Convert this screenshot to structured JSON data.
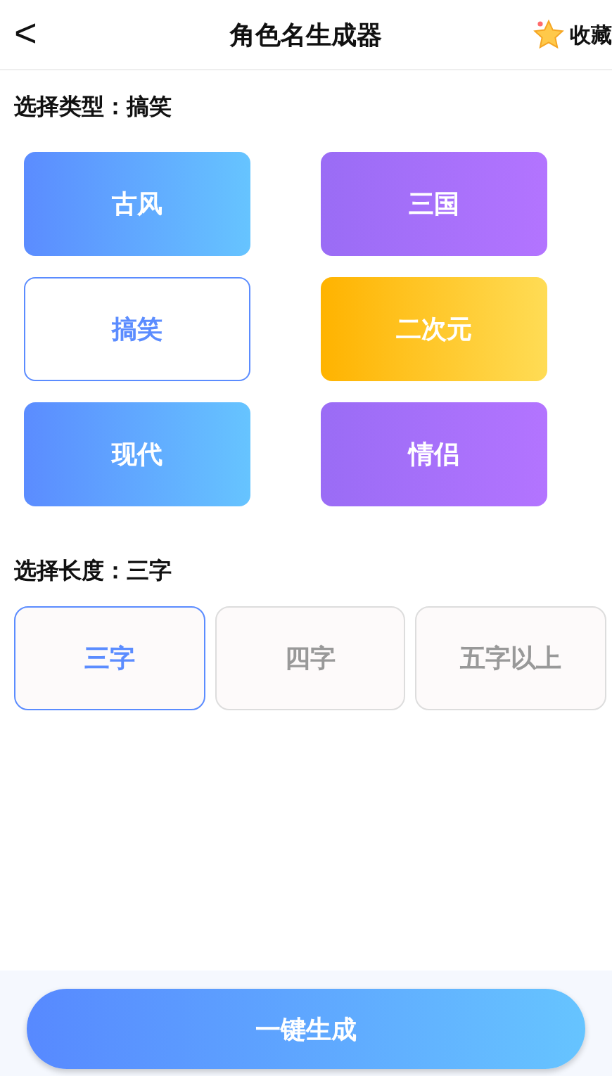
{
  "header": {
    "back": "<",
    "title": "角色名生成器",
    "favorite": "收藏"
  },
  "type_section": {
    "label": "选择类型：搞笑",
    "options": [
      {
        "label": "古风",
        "kind": "blue",
        "selected": false
      },
      {
        "label": "三国",
        "kind": "purple",
        "selected": false
      },
      {
        "label": "搞笑",
        "kind": "blue",
        "selected": true
      },
      {
        "label": "二次元",
        "kind": "gold",
        "selected": false
      },
      {
        "label": "现代",
        "kind": "blue",
        "selected": false
      },
      {
        "label": "情侣",
        "kind": "purple",
        "selected": false
      }
    ]
  },
  "length_section": {
    "label": "选择长度：三字",
    "options": [
      {
        "label": "三字",
        "selected": true
      },
      {
        "label": "四字",
        "selected": false
      },
      {
        "label": "五字以上",
        "selected": false
      }
    ]
  },
  "generate_button": "一键生成"
}
